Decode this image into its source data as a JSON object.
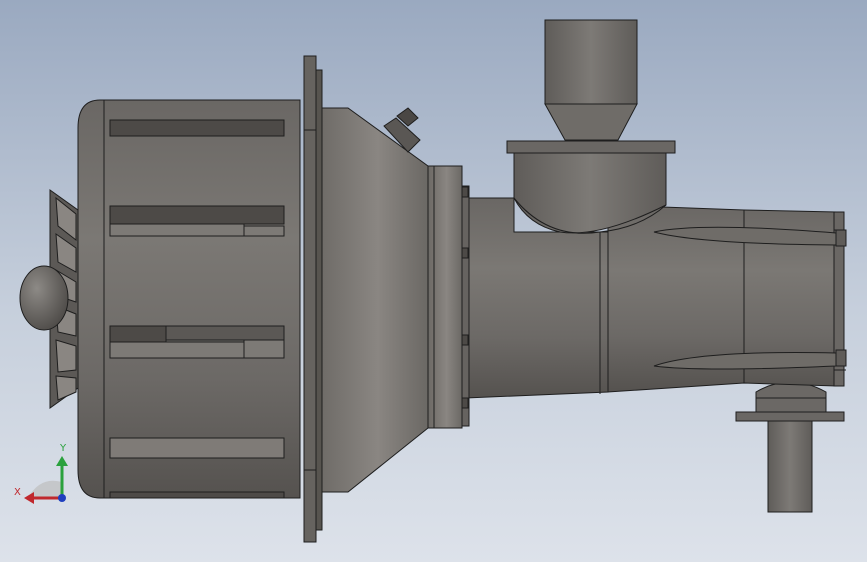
{
  "viewport": {
    "background_top": "#9aa9c0",
    "background_bottom": "#dde2ea"
  },
  "model": {
    "part_color": "#6f6c68",
    "edge_color": "#1e1e1e"
  },
  "triad": {
    "x_label": "X",
    "y_label": "Y",
    "x_color": "#c0282d",
    "y_color": "#2aa13d",
    "z_color": "#1f3fbf"
  }
}
